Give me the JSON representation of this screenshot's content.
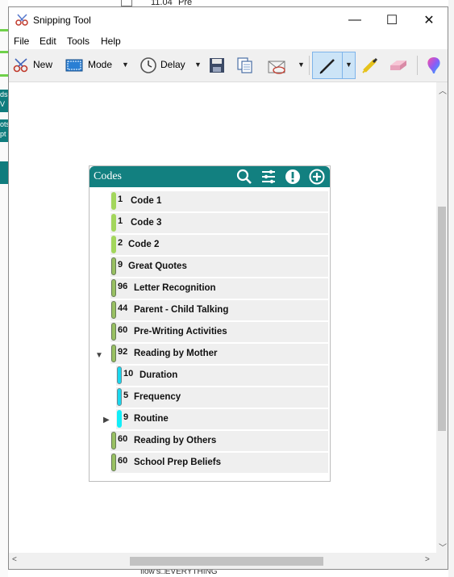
{
  "background": {
    "top_number": "11.04",
    "top_text": "Pre",
    "bottom_text": "flow's□EVERYTHING",
    "left_fragments": [
      "ds",
      "V",
      "ots",
      "pt"
    ]
  },
  "window": {
    "title": "Snipping Tool",
    "minimize_glyph": "—",
    "maximize_glyph": "☐",
    "close_glyph": "✕"
  },
  "menu": {
    "file": "File",
    "edit": "Edit",
    "tools": "Tools",
    "help": "Help"
  },
  "toolbar": {
    "new_label": "New",
    "mode_label": "Mode",
    "delay_label": "Delay",
    "dropdown_glyph": "▼"
  },
  "codes_panel": {
    "title": "Codes",
    "codes": [
      {
        "count": "1",
        "name": "Code 1"
      },
      {
        "count": "1",
        "name": "Code 3"
      },
      {
        "count": "2",
        "name": "Code 2"
      },
      {
        "count": "9",
        "name": "Great Quotes"
      },
      {
        "count": "96",
        "name": "Letter Recognition"
      },
      {
        "count": "44",
        "name": "Parent - Child Talking"
      },
      {
        "count": "60",
        "name": "Pre-Writing Activities"
      },
      {
        "count": "92",
        "name": "Reading by Mother",
        "expanded": true
      },
      {
        "count": "10",
        "name": "Duration",
        "child": true
      },
      {
        "count": "5",
        "name": "Frequency",
        "child": true
      },
      {
        "count": "9",
        "name": "Routine",
        "child": true,
        "collapsed": true
      },
      {
        "count": "60",
        "name": "Reading by Others"
      },
      {
        "count": "60",
        "name": "School Prep Beliefs"
      }
    ]
  },
  "colors": {
    "teal_header": "#128080",
    "green_pill": "#a3d65c",
    "cyan_pill": "#19d7ee",
    "accent_blue": "#cce4f7"
  }
}
